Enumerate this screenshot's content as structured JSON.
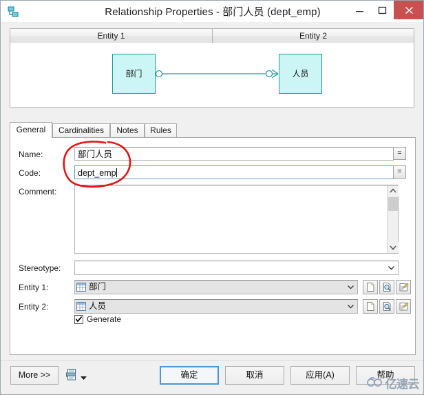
{
  "window": {
    "title": "Relationship Properties - 部门人员 (dept_emp)",
    "app_icon": "relationship-icon",
    "controls": {
      "minimize": "minimize-icon",
      "maximize": "maximize-icon",
      "close": "close-icon"
    },
    "close_color": "#c75050"
  },
  "preview": {
    "columns": [
      {
        "label": "Entity 1"
      },
      {
        "label": "Entity 2"
      }
    ],
    "entities": [
      {
        "name": "部门",
        "fill": "#ccf5f5",
        "stroke": "#1d9a9a"
      },
      {
        "name": "人员",
        "fill": "#ccf5f5",
        "stroke": "#1d9a9a"
      }
    ],
    "connector": "one-to-many-crowfoot"
  },
  "tabs": [
    {
      "label": "General",
      "active": true
    },
    {
      "label": "Cardinalities",
      "active": false
    },
    {
      "label": "Notes",
      "active": false
    },
    {
      "label": "Rules",
      "active": false
    }
  ],
  "general": {
    "name": {
      "label": "Name:",
      "value": "部门人员"
    },
    "code": {
      "label": "Code:",
      "value": "dept_emp",
      "focused": true
    },
    "comment": {
      "label": "Comment:",
      "value": ""
    },
    "stereotype": {
      "label": "Stereotype:",
      "value": ""
    },
    "entity1": {
      "label": "Entity 1:",
      "value": "部门",
      "icon": "table-icon"
    },
    "entity2": {
      "label": "Entity 2:",
      "value": "人员",
      "icon": "table-icon"
    },
    "generate": {
      "label": "Generate",
      "checked": true
    },
    "equals_button_label": "=",
    "row_buttons": [
      "create-icon",
      "browse-icon",
      "properties-icon"
    ]
  },
  "annotation": {
    "shape": "red-hand-drawn-ellipse",
    "color": "#e01515"
  },
  "footer": {
    "more": "More >>",
    "report_icon": "report-icon",
    "report_dropdown": "chevron-down-icon",
    "ok": "确定",
    "cancel": "取消",
    "apply": "应用(A)",
    "help": "帮助",
    "default_button": "确定",
    "default_border_color": "#4a96d8"
  },
  "watermark": {
    "text": "亿速云",
    "icon": "cloud-logo-icon",
    "color": "#8e9fb4"
  }
}
